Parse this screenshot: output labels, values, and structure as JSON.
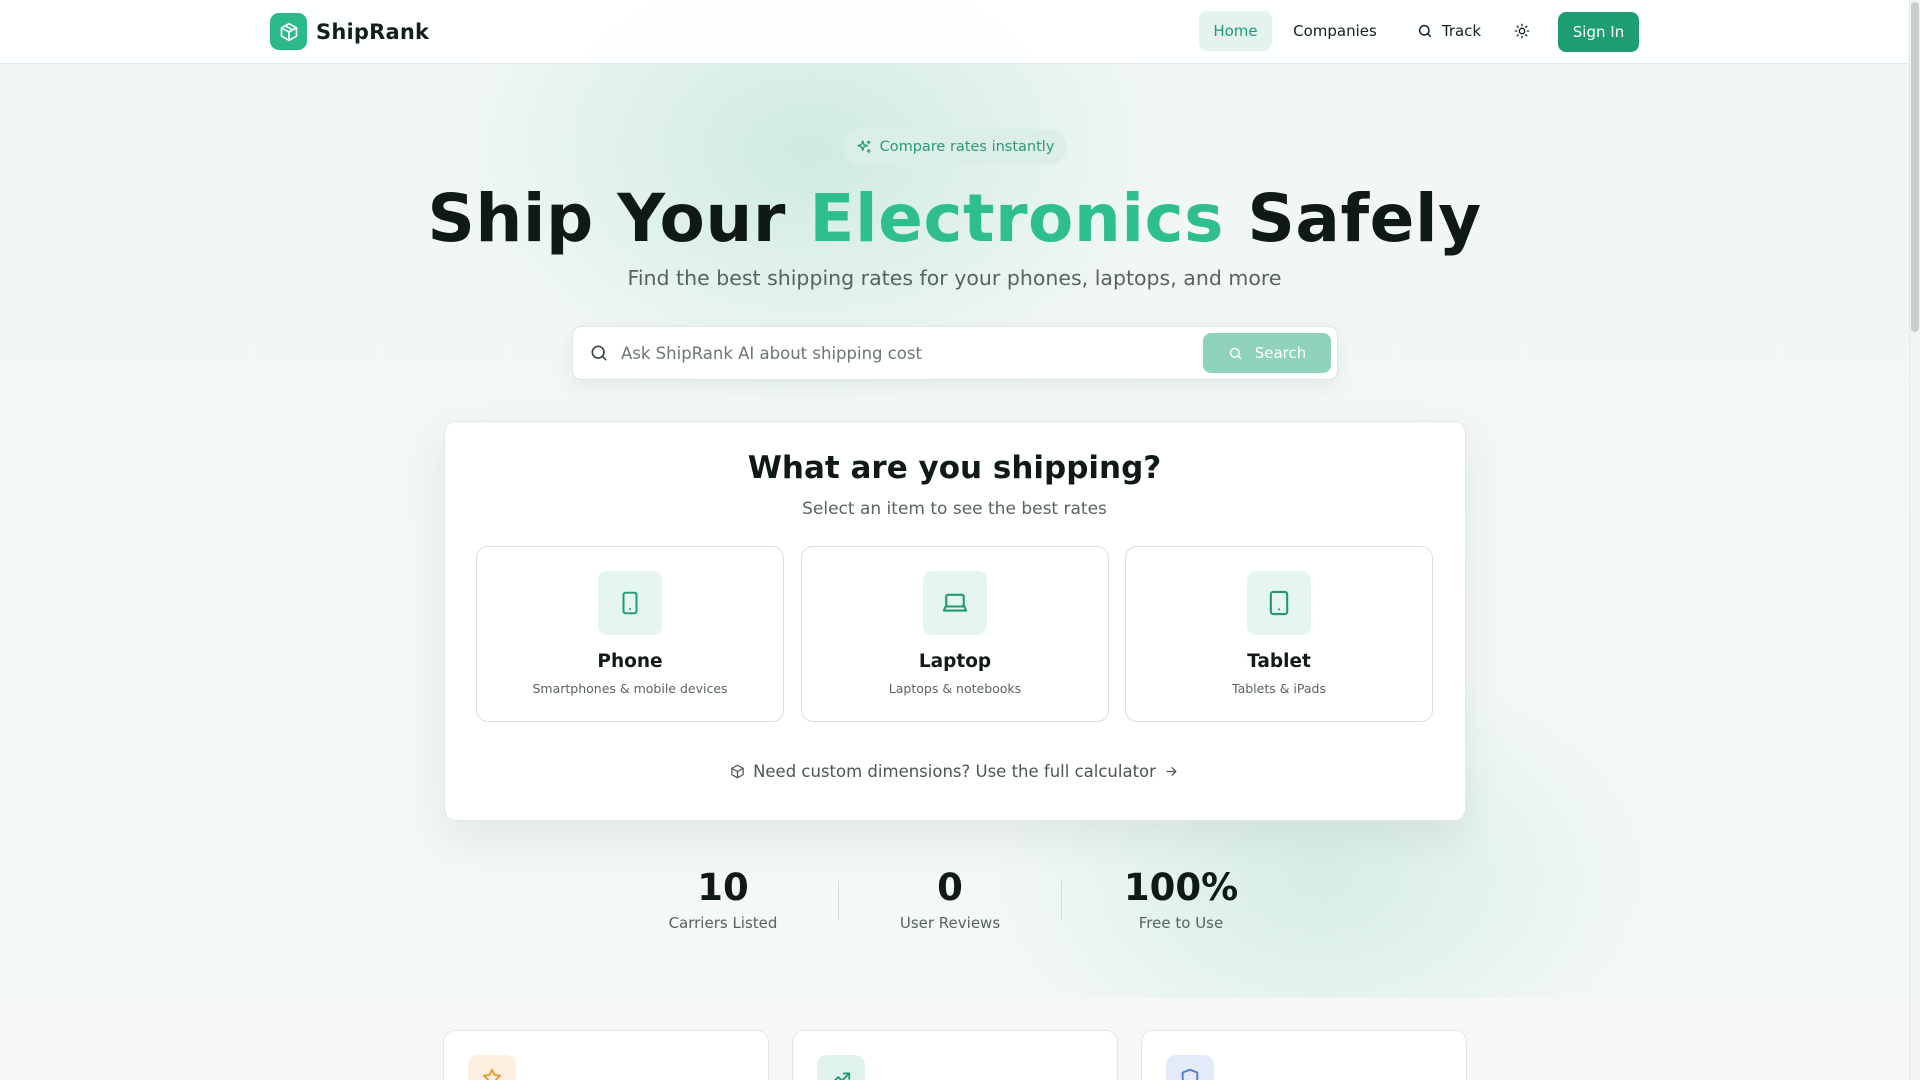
{
  "header": {
    "brand_name": "ShipRank",
    "nav": {
      "home": "Home",
      "companies": "Companies",
      "track": "Track"
    },
    "sign_in": "Sign In"
  },
  "hero": {
    "pill": "Compare rates instantly",
    "title_before": "Ship Your ",
    "title_accent": "Electronics",
    "title_after": " Safely",
    "subtitle": "Find the best shipping rates for your phones, laptops, and more"
  },
  "search": {
    "placeholder": "Ask ShipRank AI about shipping cost",
    "value": "",
    "button": "Search"
  },
  "shipping_card": {
    "title": "What are you shipping?",
    "subtitle": "Select an item to see the best rates",
    "options": [
      {
        "label": "Phone",
        "description": "Smartphones & mobile devices",
        "icon": "smartphone-icon"
      },
      {
        "label": "Laptop",
        "description": "Laptops & notebooks",
        "icon": "laptop-icon"
      },
      {
        "label": "Tablet",
        "description": "Tablets & iPads",
        "icon": "tablet-icon"
      }
    ],
    "custom_link": "Need custom dimensions? Use the full calculator"
  },
  "stats": [
    {
      "value": "10",
      "label": "Carriers Listed"
    },
    {
      "value": "0",
      "label": "User Reviews"
    },
    {
      "value": "100%",
      "label": "Free to Use"
    }
  ],
  "features": [
    {
      "icon": "star-icon"
    },
    {
      "icon": "trending-up-icon"
    },
    {
      "icon": "shield-icon"
    }
  ],
  "colors": {
    "brand": "#2bb98a",
    "primary_button": "#1e9d72",
    "accent_text": "#2fbf8c",
    "search_button": "#8fd3bb"
  }
}
